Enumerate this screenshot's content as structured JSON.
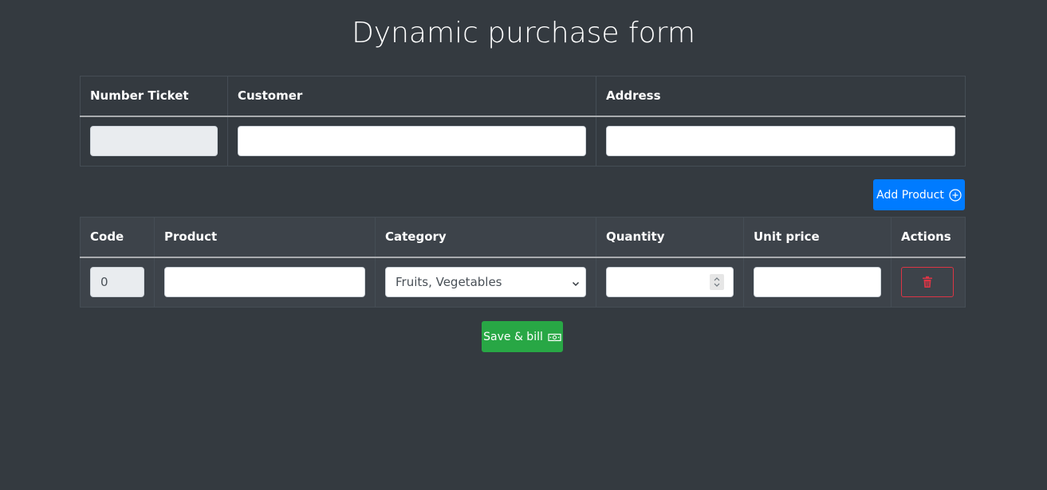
{
  "page": {
    "title": "Dynamic purchase form"
  },
  "ticket_table": {
    "headers": {
      "number_ticket": "Number Ticket",
      "customer": "Customer",
      "address": "Address"
    },
    "values": {
      "number_ticket": "",
      "customer": "",
      "address": ""
    }
  },
  "toolbar": {
    "add_product_label": "Add Product",
    "add_product_icon": "plus-circle-icon"
  },
  "products_table": {
    "headers": {
      "code": "Code",
      "product": "Product",
      "category": "Category",
      "quantity": "Quantity",
      "unit_price": "Unit price",
      "actions": "Actions"
    },
    "rows": [
      {
        "code": "0",
        "product": "",
        "category": "Fruits, Vegetables",
        "quantity": "",
        "unit_price": "",
        "delete_icon": "trash-icon"
      }
    ]
  },
  "footer": {
    "save_label": "Save & bill",
    "save_icon": "cash-icon"
  },
  "colors": {
    "background": "#343a40",
    "primary": "#007bff",
    "success": "#28a745",
    "danger": "#dc3545"
  }
}
